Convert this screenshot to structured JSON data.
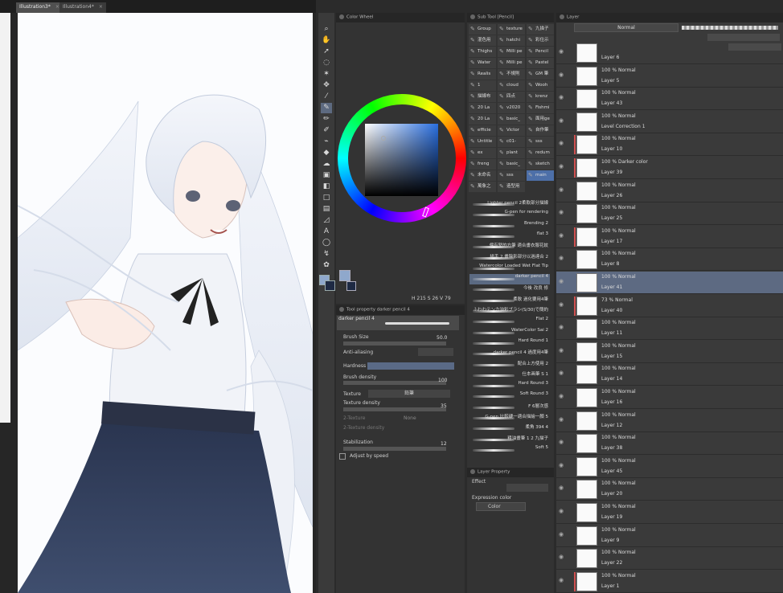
{
  "tabs": [
    {
      "label": "Illustration3*",
      "active": true
    },
    {
      "label": "Illustration4*",
      "active": false
    }
  ],
  "colorwheel": {
    "title": "Color Wheel",
    "readout": "H 215 S 26 V 79"
  },
  "tool_property": {
    "title": "Tool property darker pencil 4",
    "brush_name": "darker pencil 4",
    "brush_size_label": "Brush Size",
    "brush_size_value": "50.0",
    "antialiasing_label": "Anti-aliasing",
    "hardness_label": "Hardness",
    "brush_density_label": "Brush density",
    "brush_density_value": "100",
    "texture_label": "Texture",
    "texture_value": "鉛筆",
    "texture_density_label": "Texture density",
    "texture_density_value": "35",
    "two_texture_label": "2-Texture",
    "two_texture_value": "None",
    "two_texture_density_label": "2-Texture density",
    "stabilization_label": "Stabilization",
    "stabilization_value": "12",
    "adjust_by_speed_label": "Adjust by speed"
  },
  "subtool": {
    "title": "Sub Tool [Pencil]",
    "grid": [
      [
        "Group",
        "texture",
        "九描子"
      ],
      [
        "混色用",
        "hatchi",
        "彩住示"
      ],
      [
        "Thighs",
        "Milli pe",
        "Pencil"
      ],
      [
        "Water",
        "Milli pe",
        "Pastel"
      ],
      [
        "Realis",
        "不規則",
        "GM 筆"
      ],
      [
        "1",
        "cloud",
        "Wooh"
      ],
      [
        "描線布",
        "四点",
        "krenz"
      ],
      [
        "20 La",
        "v2020",
        "Fishmi"
      ],
      [
        "20 La",
        "basic_",
        "面用ge"
      ],
      [
        "efficie",
        "Victor",
        "自作筆"
      ],
      [
        "Untitle",
        "c01-",
        "sss"
      ],
      [
        "ex",
        "plant",
        "redum"
      ],
      [
        "freng",
        "basic_",
        "sketch"
      ],
      [
        "未命名",
        "sss",
        "main"
      ],
      [
        "萬象之",
        "造型用",
        ""
      ]
    ],
    "brushes": [
      "Lighter pencil 2柔軟部分描線",
      "G-pen  for rendering",
      "Brending 2",
      "flat 3",
      "偏有堅的方筆 適合畫衣服花紋",
      "描手 2 畫陰影部分以過達合 2",
      "Watercolor Loaded Wet Flat Tip",
      "darker pencil 4",
      "今後 改良 修",
      "柔軟 過化要用4筆",
      "ふわわテン力油彩ブラシ(S/30)で簡約",
      "Flat 2",
      "WaterColor Sai 2",
      "Hard Round 1",
      "darker pencil 4 過度用4筆",
      "配合上方使用 2",
      "仕本画筆 S 1",
      "Hard Round 3",
      "Soft Round 3",
      "F 6層次感",
      "G-pen  比較硬一適合描繪一顏 5",
      "柔角 394 4",
      "粗油畫筆 1 2 九描子",
      "Soft 5"
    ]
  },
  "layer_property": {
    "title": "Layer Property",
    "effect_label": "Effect",
    "expression_color_label": "Expression color",
    "expression_color_value": "Color"
  },
  "layer_panel": {
    "title": "Layer",
    "blend_mode": "Normal",
    "layers": [
      {
        "mode": "",
        "name": "Layer 6",
        "selected": false,
        "clip": false
      },
      {
        "mode": "100 % Normal",
        "name": "Layer 5",
        "selected": false,
        "clip": false
      },
      {
        "mode": "100 % Normal",
        "name": "Layer 43",
        "selected": false,
        "clip": false
      },
      {
        "mode": "100 % Normal",
        "name": "Level Correction 1",
        "selected": false,
        "clip": false
      },
      {
        "mode": "100 % Normal",
        "name": "Layer 10",
        "selected": false,
        "clip": true
      },
      {
        "mode": "100 % Darker color",
        "name": "Layer 39",
        "selected": false,
        "clip": true
      },
      {
        "mode": "100 % Normal",
        "name": "Layer 26",
        "selected": false,
        "clip": false
      },
      {
        "mode": "100 % Normal",
        "name": "Layer 25",
        "selected": false,
        "clip": false
      },
      {
        "mode": "100 % Normal",
        "name": "Layer 17",
        "selected": false,
        "clip": true
      },
      {
        "mode": "100 % Normal",
        "name": "Layer 8",
        "selected": false,
        "clip": false
      },
      {
        "mode": "100 % Normal",
        "name": "Layer 41",
        "selected": true,
        "clip": false
      },
      {
        "mode": "73 % Normal",
        "name": "Layer 40",
        "selected": false,
        "clip": true
      },
      {
        "mode": "100 % Normal",
        "name": "Layer 11",
        "selected": false,
        "clip": false
      },
      {
        "mode": "100 % Normal",
        "name": "Layer 15",
        "selected": false,
        "clip": false
      },
      {
        "mode": "100 % Normal",
        "name": "Layer 14",
        "selected": false,
        "clip": false
      },
      {
        "mode": "100 % Normal",
        "name": "Layer 16",
        "selected": false,
        "clip": false
      },
      {
        "mode": "100 % Normal",
        "name": "Layer 12",
        "selected": false,
        "clip": false
      },
      {
        "mode": "100 % Normal",
        "name": "Layer 38",
        "selected": false,
        "clip": false
      },
      {
        "mode": "100 % Normal",
        "name": "Layer 45",
        "selected": false,
        "clip": false
      },
      {
        "mode": "100 % Normal",
        "name": "Layer 20",
        "selected": false,
        "clip": false
      },
      {
        "mode": "100 % Normal",
        "name": "Layer 19",
        "selected": false,
        "clip": false
      },
      {
        "mode": "100 % Normal",
        "name": "Layer 9",
        "selected": false,
        "clip": false
      },
      {
        "mode": "100 % Normal",
        "name": "Layer 22",
        "selected": false,
        "clip": false
      },
      {
        "mode": "100 % Normal",
        "name": "Layer 1",
        "selected": false,
        "clip": true
      }
    ]
  },
  "colors": {
    "main_color": "#8fa8cc",
    "sub_color": "#1e2a44",
    "selection": "#5d6a82",
    "accent": "#4d6fa8"
  }
}
